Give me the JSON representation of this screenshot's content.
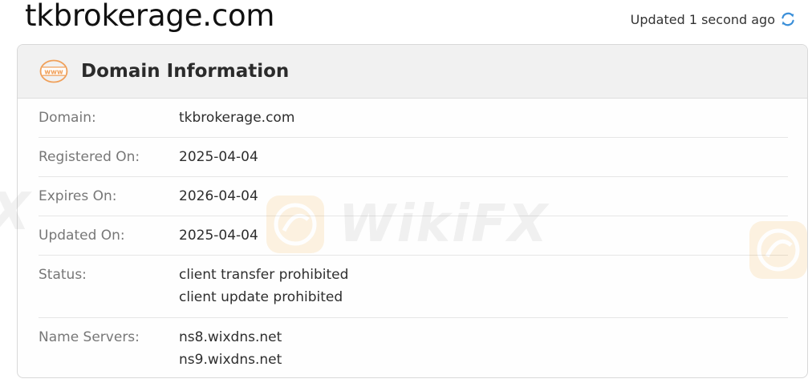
{
  "page": {
    "title": "tkbrokerage.com",
    "updated_text": "Updated 1 second ago"
  },
  "card": {
    "title": "Domain Information",
    "header_icon_text": "www",
    "rows": [
      {
        "label": "Domain:",
        "values": [
          "tkbrokerage.com"
        ]
      },
      {
        "label": "Registered On:",
        "values": [
          "2025-04-04"
        ]
      },
      {
        "label": "Expires On:",
        "values": [
          "2026-04-04"
        ]
      },
      {
        "label": "Updated On:",
        "values": [
          "2025-04-04"
        ]
      },
      {
        "label": "Status:",
        "values": [
          "client transfer prohibited",
          "client update prohibited"
        ]
      },
      {
        "label": "Name Servers:",
        "values": [
          "ns8.wixdns.net",
          "ns9.wixdns.net"
        ]
      }
    ]
  },
  "watermark": {
    "text": "WikiFX",
    "edge_fragment": "X"
  },
  "icons": {
    "refresh": "refresh-icon",
    "www": "www-globe-icon"
  },
  "colors": {
    "accent_orange": "#f0a05a",
    "refresh_blue": "#3b8fd9",
    "header_bg": "#f1f1f1"
  }
}
